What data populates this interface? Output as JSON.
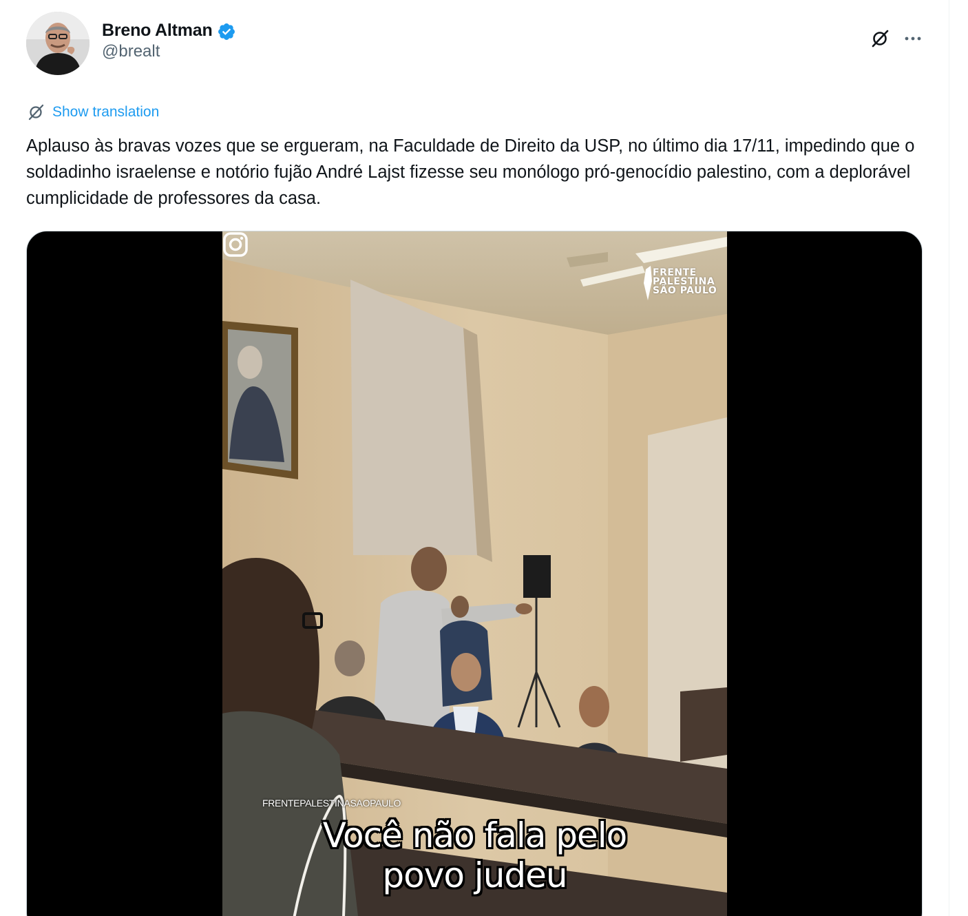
{
  "author": {
    "name": "Breno Altman",
    "handle": "@brealt",
    "verified": true
  },
  "actions": {
    "grok_icon": "grok-icon",
    "more_icon": "more-icon"
  },
  "translation": {
    "label": "Show translation",
    "icon": "translate-icon"
  },
  "tweet": {
    "text": "Aplauso às bravas vozes que se ergueram, na Faculdade de Direito da USP, no último dia 17/11, impedindo que o soldadinho israelense e notório fujão André Lajst fizesse seu monólogo pró-genocídio palestino, com a deplorável cumplicidade de professores da casa."
  },
  "video": {
    "watermark": [
      "FRENTE",
      "PALESTINA",
      "SÃO PAULO"
    ],
    "instagram_handle": "FRENTEPALESTINASAOPAULO",
    "caption_line1": "Você não fala pelo",
    "caption_line2": "povo judeu"
  },
  "colors": {
    "accent": "#1d9bf0",
    "text": "#0f1419",
    "secondary": "#536471",
    "border": "#cfd9de"
  }
}
